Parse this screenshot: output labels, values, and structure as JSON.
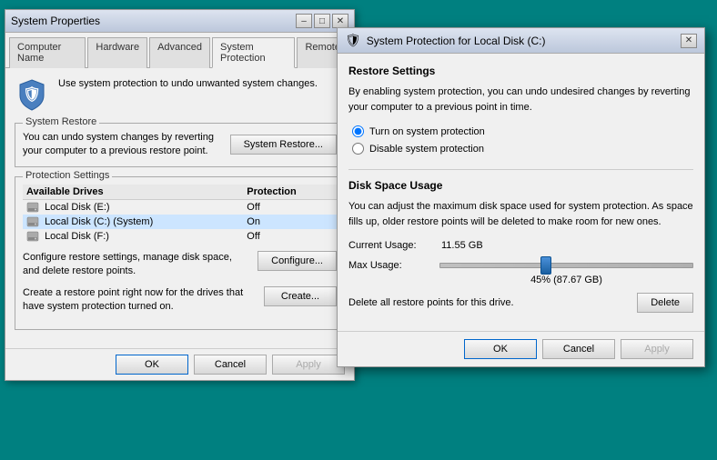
{
  "sysProps": {
    "title": "System Properties",
    "tabs": [
      {
        "label": "Computer Name",
        "active": false
      },
      {
        "label": "Hardware",
        "active": false
      },
      {
        "label": "Advanced",
        "active": false
      },
      {
        "label": "System Protection",
        "active": true
      },
      {
        "label": "Remote",
        "active": false
      }
    ],
    "infoText": "Use system protection to undo unwanted system changes.",
    "restoreGroup": {
      "title": "System Restore",
      "description": "You can undo system changes by reverting your computer to a previous restore point.",
      "buttonLabel": "System Restore..."
    },
    "protectionGroup": {
      "title": "Protection Settings",
      "tableHeaders": [
        "Available Drives",
        "Protection"
      ],
      "drives": [
        {
          "name": "Local Disk (E:)",
          "protection": "Off",
          "selected": false
        },
        {
          "name": "Local Disk (C:) (System)",
          "protection": "On",
          "selected": true
        },
        {
          "name": "Local Disk (F:)",
          "protection": "Off",
          "selected": false
        }
      ]
    },
    "configRow": {
      "text": "Configure restore settings, manage disk space, and delete restore points.",
      "buttonLabel": "Configure..."
    },
    "createRow": {
      "text": "Create a restore point right now for the drives that have system protection turned on.",
      "buttonLabel": "Create..."
    },
    "bottomButtons": {
      "ok": "OK",
      "cancel": "Cancel",
      "apply": "Apply"
    }
  },
  "spDialog": {
    "titleIcon": "🛡",
    "title": "System Protection for Local Disk (C:)",
    "restoreSettings": {
      "sectionTitle": "Restore Settings",
      "description": "By enabling system protection, you can undo undesired changes by reverting your computer to a previous point in time.",
      "options": [
        {
          "label": "Turn on system protection",
          "checked": true
        },
        {
          "label": "Disable system protection",
          "checked": false
        }
      ]
    },
    "diskSpaceUsage": {
      "sectionTitle": "Disk Space Usage",
      "description": "You can adjust the maximum disk space used for system protection. As space fills up, older restore points will be deleted to make room for new ones.",
      "currentUsageLabel": "Current Usage:",
      "currentUsageValue": "11.55 GB",
      "maxUsageLabel": "Max Usage:",
      "sliderPct": "45% (87.67 GB)",
      "deleteText": "Delete all restore points for this drive.",
      "deleteButton": "Delete"
    },
    "bottomButtons": {
      "ok": "OK",
      "cancel": "Cancel",
      "apply": "Apply"
    }
  }
}
